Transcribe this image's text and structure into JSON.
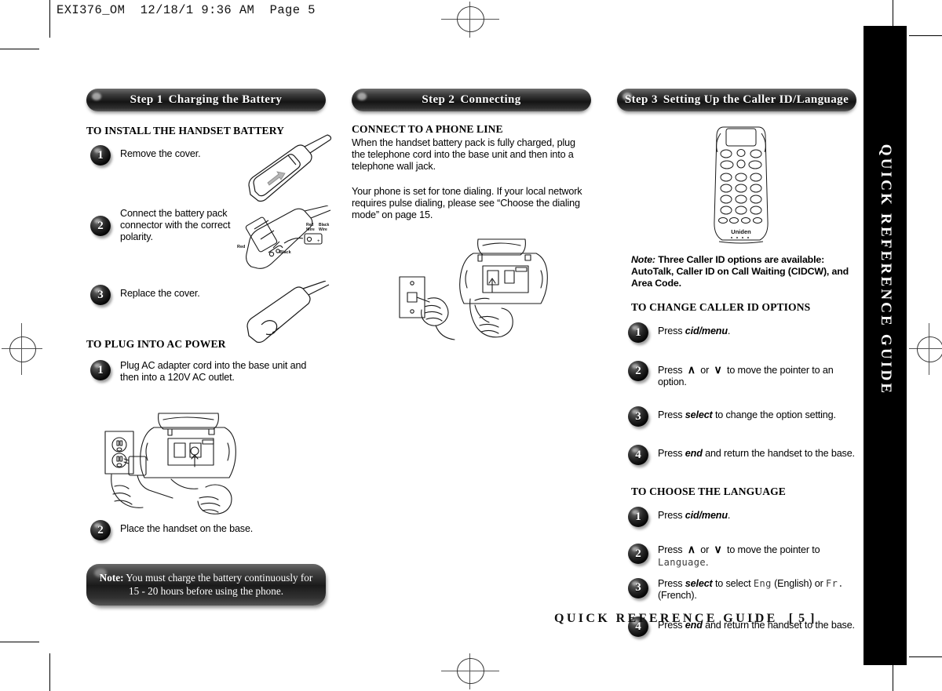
{
  "file_header": "EXI376_OM  12/18/1 9:36 AM  Page 5",
  "side_tab": {
    "label": "QUICK REFERENCE GUIDE"
  },
  "footer": {
    "title": "QUICK REFERENCE GUIDE",
    "page": "[ 5 ]"
  },
  "columns": {
    "col1": {
      "pill": {
        "step": "Step 1",
        "title": "Charging the Battery"
      },
      "heading1": "TO INSTALL THE HANDSET BATTERY",
      "steps1": [
        {
          "num": "1",
          "text": "Remove the cover."
        },
        {
          "num": "2",
          "text": "Connect the battery pack connector with the correct polarity."
        },
        {
          "num": "3",
          "text": "Replace the cover."
        }
      ],
      "heading2": "TO PLUG INTO AC POWER",
      "steps2": [
        {
          "num": "1",
          "text": "Plug AC adapter cord into the base unit and then into a 120V AC outlet."
        },
        {
          "num": "2",
          "text": "Place the handset on the base."
        }
      ],
      "note": {
        "label": "Note:",
        "line1": " You must charge the battery continuously for",
        "line2": "15 - 20 hours before using the phone."
      },
      "illustration_labels": {
        "red_wire": "Red Wire",
        "black_wire": "Black Wire",
        "red": "Red",
        "black": "Black"
      }
    },
    "col2": {
      "pill": {
        "step": "Step 2",
        "title": "Connecting"
      },
      "heading": "CONNECT TO A PHONE LINE",
      "para1": "When the handset battery pack is fully charged, plug the telephone cord into the base unit and then into a telephone wall jack.",
      "para2": "Your phone is set for tone dialing. If your local network requires pulse dialing, please see “Choose the dialing mode” on page 15."
    },
    "col3": {
      "pill": {
        "step": "Step 3",
        "title": "Setting Up the Caller ID/Language"
      },
      "handset_brand": "Uniden",
      "note": {
        "label": "Note:",
        "text": " Three Caller ID options are available: AutoTalk, Caller ID on Call Waiting (CIDCW), and Area Code."
      },
      "heading1": "TO CHANGE CALLER ID OPTIONS",
      "steps1": [
        {
          "num": "1",
          "pre": "Press ",
          "key": "cid/menu",
          "post": "."
        },
        {
          "num": "2",
          "pre": "Press ",
          "up": "∧",
          "mid": " or ",
          "down": "∨",
          "post": "  to move the pointer to an option."
        },
        {
          "num": "3",
          "pre": "Press ",
          "key": "select",
          "post": " to change the option setting."
        },
        {
          "num": "4",
          "pre": "Press ",
          "key": "end",
          "post": " and return the handset to the base."
        }
      ],
      "heading2": "TO CHOOSE THE LANGUAGE",
      "steps2": [
        {
          "num": "1",
          "pre": "Press ",
          "key": "cid/menu",
          "post": "."
        },
        {
          "num": "2",
          "pre": "Press ",
          "up": "∧",
          "mid": " or ",
          "down": "∨",
          "post": "  to move the pointer to ",
          "lcd": "Language",
          "tail": "."
        },
        {
          "num": "3",
          "pre": "Press ",
          "key": "select",
          "post": " to select ",
          "lcd": "Eng",
          "mid2": " (English) or ",
          "lcd2": "Fr.",
          "tail": " (French)."
        },
        {
          "num": "4",
          "pre": "Press ",
          "key": "end",
          "post": " and return the handset to the base."
        }
      ]
    }
  },
  "colors": {
    "ink": "#000000",
    "pill_dark": "#141414",
    "paper": "#ffffff",
    "line_art": "#1a1a1a"
  }
}
